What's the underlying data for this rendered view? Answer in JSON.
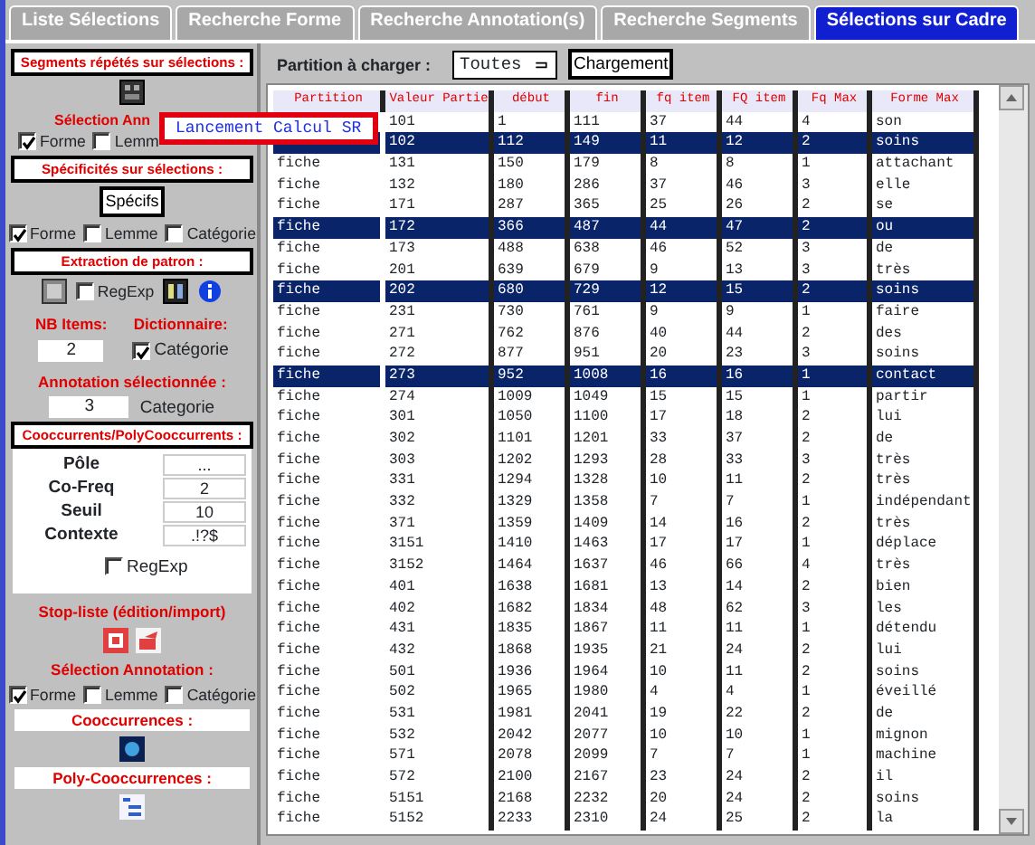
{
  "tabs": [
    {
      "label": "Liste Sélections",
      "selected": false
    },
    {
      "label": "Recherche Forme",
      "selected": false
    },
    {
      "label": "Recherche Annotation(s)",
      "selected": false
    },
    {
      "label": "Recherche Segments",
      "selected": false
    },
    {
      "label": "Sélections sur Cadre",
      "selected": true
    }
  ],
  "segments": {
    "title": "Segments répétés sur sélections :",
    "annotation_label": "Sélection Ann",
    "tooltip": "Lancement Calcul SR",
    "checkboxes": [
      {
        "label": "Forme",
        "checked": true
      },
      {
        "label": "Lemm",
        "checked": false
      }
    ]
  },
  "specificites": {
    "title": "Spécificités sur sélections :",
    "button": "Spécifs",
    "checkboxes": [
      {
        "label": "Forme",
        "checked": true
      },
      {
        "label": "Lemme",
        "checked": false
      },
      {
        "label": "Catégorie",
        "checked": false
      }
    ]
  },
  "extraction": {
    "title": "Extraction de patron :",
    "regexp": {
      "label": "RegExp",
      "checked": false
    }
  },
  "nb_items": {
    "label": "NB Items:",
    "value": "2"
  },
  "dictionnaire": {
    "label": "Dictionnaire:",
    "checkbox": {
      "label": "Catégorie",
      "checked": true
    }
  },
  "annotation": {
    "label": "Annotation sélectionnée :",
    "value": "3",
    "unit": "Categorie"
  },
  "cooccurrents": {
    "title": "Cooccurrents/PolyCooccurrents :",
    "fields": [
      {
        "label": "Pôle",
        "value": "..."
      },
      {
        "label": "Co-Freq",
        "value": "2"
      },
      {
        "label": "Seuil",
        "value": "10"
      },
      {
        "label": "Contexte",
        "value": ".!?$"
      }
    ],
    "regexp": {
      "label": "RegExp",
      "checked": false
    }
  },
  "stop_list": {
    "title": "Stop-liste (édition/import)"
  },
  "selection_annotation": {
    "title": "Sélection Annotation :",
    "checkboxes": [
      {
        "label": "Forme",
        "checked": true
      },
      {
        "label": "Lemme",
        "checked": false
      },
      {
        "label": "Catégorie",
        "checked": false
      }
    ]
  },
  "cooccurrences": {
    "title": "Cooccurrences :"
  },
  "poly_cooccurrences": {
    "title": "Poly-Cooccurrences :"
  },
  "partition": {
    "label": "Partition à charger :",
    "select": "Toutes",
    "button": "Chargement"
  },
  "table": {
    "columns": [
      "Partition",
      "Valeur Partie",
      "début",
      "fin",
      "fq item",
      "FQ item",
      "Fq Max",
      "Forme Max"
    ],
    "rows": [
      {
        "values": [
          "101",
          "1",
          "111",
          "37",
          "44",
          "4",
          "son"
        ],
        "selected": false
      },
      {
        "values": [
          "102",
          "112",
          "149",
          "11",
          "12",
          "2",
          "soins"
        ],
        "selected": true
      },
      {
        "partition": "fiche",
        "values": [
          "131",
          "150",
          "179",
          "8",
          "8",
          "1",
          "attachant"
        ],
        "selected": false
      },
      {
        "partition": "fiche",
        "values": [
          "132",
          "180",
          "286",
          "37",
          "46",
          "3",
          "elle"
        ],
        "selected": false
      },
      {
        "partition": "fiche",
        "values": [
          "171",
          "287",
          "365",
          "25",
          "26",
          "2",
          "se"
        ],
        "selected": false
      },
      {
        "partition": "fiche",
        "values": [
          "172",
          "366",
          "487",
          "44",
          "47",
          "2",
          "ou"
        ],
        "selected": true
      },
      {
        "partition": "fiche",
        "values": [
          "173",
          "488",
          "638",
          "46",
          "52",
          "3",
          "de"
        ],
        "selected": false
      },
      {
        "partition": "fiche",
        "values": [
          "201",
          "639",
          "679",
          "9",
          "13",
          "3",
          "très"
        ],
        "selected": false
      },
      {
        "partition": "fiche",
        "values": [
          "202",
          "680",
          "729",
          "12",
          "15",
          "2",
          "soins"
        ],
        "selected": true
      },
      {
        "partition": "fiche",
        "values": [
          "231",
          "730",
          "761",
          "9",
          "9",
          "1",
          "faire"
        ],
        "selected": false
      },
      {
        "partition": "fiche",
        "values": [
          "271",
          "762",
          "876",
          "40",
          "44",
          "2",
          "des"
        ],
        "selected": false
      },
      {
        "partition": "fiche",
        "values": [
          "272",
          "877",
          "951",
          "20",
          "23",
          "3",
          "soins"
        ],
        "selected": false
      },
      {
        "partition": "fiche",
        "values": [
          "273",
          "952",
          "1008",
          "16",
          "16",
          "1",
          "contact"
        ],
        "selected": true
      },
      {
        "partition": "fiche",
        "values": [
          "274",
          "1009",
          "1049",
          "15",
          "15",
          "1",
          "partir"
        ],
        "selected": false
      },
      {
        "partition": "fiche",
        "values": [
          "301",
          "1050",
          "1100",
          "17",
          "18",
          "2",
          "lui"
        ],
        "selected": false
      },
      {
        "partition": "fiche",
        "values": [
          "302",
          "1101",
          "1201",
          "33",
          "37",
          "2",
          "de"
        ],
        "selected": false
      },
      {
        "partition": "fiche",
        "values": [
          "303",
          "1202",
          "1293",
          "28",
          "33",
          "3",
          "très"
        ],
        "selected": false
      },
      {
        "partition": "fiche",
        "values": [
          "331",
          "1294",
          "1328",
          "10",
          "11",
          "2",
          "très"
        ],
        "selected": false
      },
      {
        "partition": "fiche",
        "values": [
          "332",
          "1329",
          "1358",
          "7",
          "7",
          "1",
          "indépendant"
        ],
        "selected": false
      },
      {
        "partition": "fiche",
        "values": [
          "371",
          "1359",
          "1409",
          "14",
          "16",
          "2",
          "très"
        ],
        "selected": false
      },
      {
        "partition": "fiche",
        "values": [
          "3151",
          "1410",
          "1463",
          "17",
          "17",
          "1",
          "déplace"
        ],
        "selected": false
      },
      {
        "partition": "fiche",
        "values": [
          "3152",
          "1464",
          "1637",
          "46",
          "66",
          "4",
          "très"
        ],
        "selected": false
      },
      {
        "partition": "fiche",
        "values": [
          "401",
          "1638",
          "1681",
          "13",
          "14",
          "2",
          "bien"
        ],
        "selected": false
      },
      {
        "partition": "fiche",
        "values": [
          "402",
          "1682",
          "1834",
          "48",
          "62",
          "3",
          "les"
        ],
        "selected": false
      },
      {
        "partition": "fiche",
        "values": [
          "431",
          "1835",
          "1867",
          "11",
          "11",
          "1",
          "détendu"
        ],
        "selected": false
      },
      {
        "partition": "fiche",
        "values": [
          "432",
          "1868",
          "1935",
          "21",
          "24",
          "2",
          "lui"
        ],
        "selected": false
      },
      {
        "partition": "fiche",
        "values": [
          "501",
          "1936",
          "1964",
          "10",
          "11",
          "2",
          "soins"
        ],
        "selected": false
      },
      {
        "partition": "fiche",
        "values": [
          "502",
          "1965",
          "1980",
          "4",
          "4",
          "1",
          "éveillé"
        ],
        "selected": false
      },
      {
        "partition": "fiche",
        "values": [
          "531",
          "1981",
          "2041",
          "19",
          "22",
          "2",
          "de"
        ],
        "selected": false
      },
      {
        "partition": "fiche",
        "values": [
          "532",
          "2042",
          "2077",
          "10",
          "10",
          "1",
          "mignon"
        ],
        "selected": false
      },
      {
        "partition": "fiche",
        "values": [
          "571",
          "2078",
          "2099",
          "7",
          "7",
          "1",
          "machine"
        ],
        "selected": false
      },
      {
        "partition": "fiche",
        "values": [
          "572",
          "2100",
          "2167",
          "23",
          "24",
          "2",
          "il"
        ],
        "selected": false
      },
      {
        "partition": "fiche",
        "values": [
          "5151",
          "2168",
          "2232",
          "20",
          "24",
          "2",
          "soins"
        ],
        "selected": false
      },
      {
        "partition": "fiche",
        "values": [
          "5152",
          "2233",
          "2310",
          "24",
          "25",
          "2",
          "la"
        ],
        "selected": false
      }
    ]
  }
}
